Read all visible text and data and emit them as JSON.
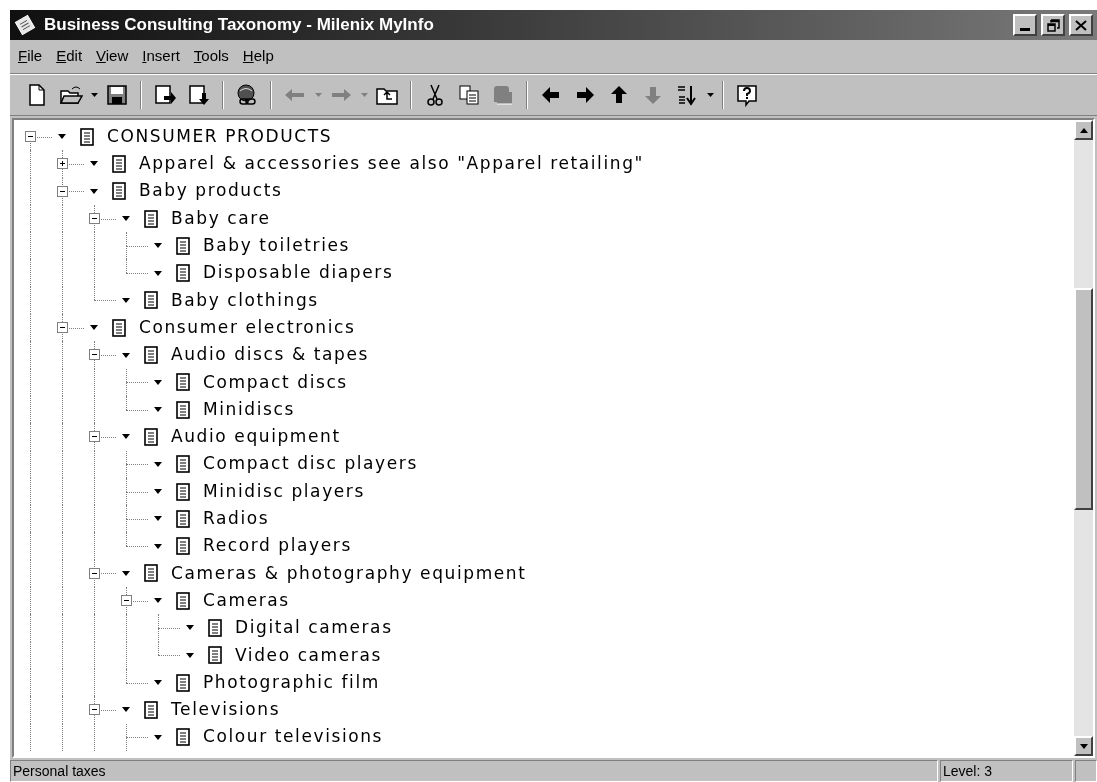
{
  "window": {
    "title": "Business Consulting Taxonomy - Milenix MyInfo"
  },
  "menu": [
    {
      "key": "F",
      "rest": "ile"
    },
    {
      "key": "E",
      "rest": "dit"
    },
    {
      "key": "V",
      "rest": "iew"
    },
    {
      "key": "I",
      "rest": "nsert"
    },
    {
      "key": "T",
      "rest": "ools"
    },
    {
      "key": "H",
      "rest": "elp"
    }
  ],
  "toolbar": [
    {
      "kind": "new",
      "disabled": false
    },
    {
      "kind": "open",
      "disabled": false
    },
    {
      "kind": "dropdown",
      "disabled": false
    },
    {
      "kind": "save",
      "disabled": false
    },
    {
      "kind": "separator"
    },
    {
      "kind": "export-right",
      "disabled": false
    },
    {
      "kind": "export-down",
      "disabled": false
    },
    {
      "kind": "separator"
    },
    {
      "kind": "globe",
      "disabled": false
    },
    {
      "kind": "separator"
    },
    {
      "kind": "back",
      "disabled": true
    },
    {
      "kind": "dropdown",
      "disabled": true
    },
    {
      "kind": "forward",
      "disabled": true
    },
    {
      "kind": "dropdown",
      "disabled": true
    },
    {
      "kind": "up-folder",
      "disabled": false
    },
    {
      "kind": "separator"
    },
    {
      "kind": "cut",
      "disabled": false
    },
    {
      "kind": "copy",
      "disabled": false
    },
    {
      "kind": "paste",
      "disabled": true
    },
    {
      "kind": "separator"
    },
    {
      "kind": "left",
      "disabled": false
    },
    {
      "kind": "right",
      "disabled": false
    },
    {
      "kind": "up",
      "disabled": false
    },
    {
      "kind": "down",
      "disabled": true
    },
    {
      "kind": "sort",
      "disabled": false
    },
    {
      "kind": "dropdown",
      "disabled": false
    },
    {
      "kind": "separator"
    },
    {
      "kind": "help",
      "disabled": false
    }
  ],
  "tree": [
    {
      "label": "CONSUMER PRODUCTS",
      "expanded": true,
      "children": [
        {
          "label": "Apparel & accessories see also \"Apparel retailing\"",
          "expanded": false
        },
        {
          "label": "Baby products",
          "expanded": true,
          "children": [
            {
              "label": "Baby care",
              "expanded": true,
              "children": [
                {
                  "label": "Baby toiletries"
                },
                {
                  "label": "Disposable diapers"
                }
              ]
            },
            {
              "label": "Baby clothings"
            }
          ]
        },
        {
          "label": "Consumer electronics",
          "expanded": true,
          "children": [
            {
              "label": "Audio discs & tapes",
              "expanded": true,
              "children": [
                {
                  "label": "Compact discs"
                },
                {
                  "label": "Minidiscs"
                }
              ]
            },
            {
              "label": "Audio equipment",
              "expanded": true,
              "children": [
                {
                  "label": "Compact disc players"
                },
                {
                  "label": "Minidisc players"
                },
                {
                  "label": "Radios"
                },
                {
                  "label": "Record players"
                }
              ]
            },
            {
              "label": "Cameras & photography equipment",
              "expanded": true,
              "children": [
                {
                  "label": "Cameras",
                  "expanded": true,
                  "children": [
                    {
                      "label": "Digital cameras"
                    },
                    {
                      "label": "Video cameras"
                    }
                  ]
                },
                {
                  "label": "Photographic film"
                }
              ]
            },
            {
              "label": "Televisions",
              "expanded": true,
              "children": [
                {
                  "label": "Colour televisions"
                }
              ]
            }
          ]
        }
      ]
    }
  ],
  "status_bar": {
    "message": "Personal taxes",
    "info": "Level: 3"
  }
}
